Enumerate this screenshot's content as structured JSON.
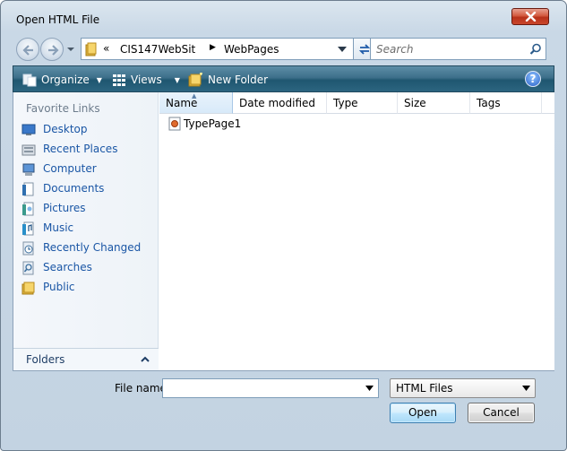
{
  "window": {
    "title": "Open HTML File"
  },
  "address": {
    "overflow": "«",
    "segments": [
      "CIS147WebSit",
      "WebPages"
    ],
    "separator": "▶"
  },
  "search": {
    "placeholder": "Search"
  },
  "toolbar": {
    "organize": "Organize",
    "views": "Views",
    "new_folder": "New Folder",
    "help": "?"
  },
  "sidebar": {
    "heading": "Favorite Links",
    "items": [
      {
        "label": "Desktop",
        "icon": "desktop-icon"
      },
      {
        "label": "Recent Places",
        "icon": "recent-places-icon"
      },
      {
        "label": "Computer",
        "icon": "computer-icon"
      },
      {
        "label": "Documents",
        "icon": "documents-icon"
      },
      {
        "label": "Pictures",
        "icon": "pictures-icon"
      },
      {
        "label": "Music",
        "icon": "music-icon"
      },
      {
        "label": "Recently Changed",
        "icon": "recently-changed-icon"
      },
      {
        "label": "Searches",
        "icon": "searches-icon"
      },
      {
        "label": "Public",
        "icon": "public-folder-icon"
      }
    ],
    "folders_label": "Folders"
  },
  "file_list": {
    "columns": [
      "Name",
      "Date modified",
      "Type",
      "Size",
      "Tags"
    ],
    "sorted_by": "Name",
    "files": [
      {
        "name": "TypePage1",
        "icon": "html-file-icon"
      }
    ]
  },
  "footer": {
    "file_name_label": "File name:",
    "file_name_value": "",
    "filter": "HTML Files",
    "open_label": "Open",
    "cancel_label": "Cancel"
  },
  "colors": {
    "toolbar": "#2c6580",
    "link": "#1a56a5",
    "close": "#c9472c"
  }
}
